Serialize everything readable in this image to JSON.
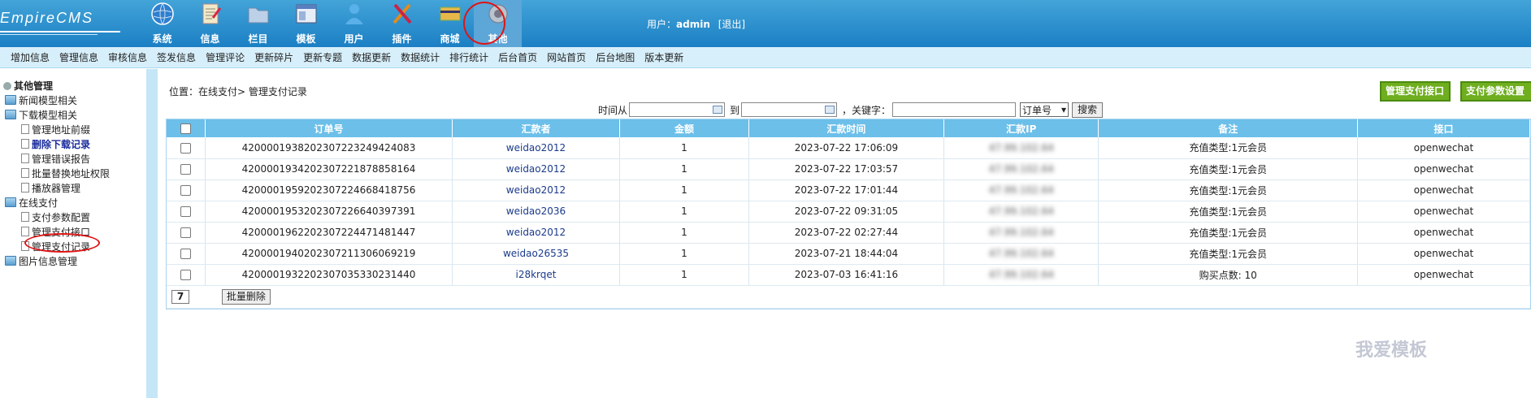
{
  "logo": {
    "text": "EmpireCMS"
  },
  "topnav": [
    {
      "label": "系统",
      "icon": "globe-icon"
    },
    {
      "label": "信息",
      "icon": "document-icon"
    },
    {
      "label": "栏目",
      "icon": "folder-icon"
    },
    {
      "label": "模板",
      "icon": "template-icon"
    },
    {
      "label": "用户",
      "icon": "user-icon"
    },
    {
      "label": "插件",
      "icon": "tools-icon"
    },
    {
      "label": "商城",
      "icon": "shop-icon"
    },
    {
      "label": "其他",
      "icon": "gear-icon"
    }
  ],
  "user": {
    "prefix": "用户：",
    "name": "admin",
    "logout": "[退出]"
  },
  "submenu": [
    "增加信息",
    "管理信息",
    "审核信息",
    "签发信息",
    "管理评论",
    "更新碎片",
    "更新专题",
    "数据更新",
    "数据统计",
    "排行统计",
    "后台首页",
    "网站首页",
    "后台地图",
    "版本更新"
  ],
  "tree": [
    {
      "label": "其他管理",
      "level": 0,
      "icon": "gear-icon"
    },
    {
      "label": "新闻模型相关",
      "level": 1,
      "icon": "folder-icon"
    },
    {
      "label": "下载模型相关",
      "level": 1,
      "icon": "folder-icon"
    },
    {
      "label": "管理地址前缀",
      "level": 2,
      "icon": "page-icon"
    },
    {
      "label": "删除下载记录",
      "level": 2,
      "icon": "page-icon",
      "bold": true
    },
    {
      "label": "管理错误报告",
      "level": 2,
      "icon": "page-icon"
    },
    {
      "label": "批量替换地址权限",
      "level": 2,
      "icon": "page-icon"
    },
    {
      "label": "播放器管理",
      "level": 2,
      "icon": "page-icon"
    },
    {
      "label": "在线支付",
      "level": 1,
      "icon": "folder-icon"
    },
    {
      "label": "支付参数配置",
      "level": 2,
      "icon": "page-icon"
    },
    {
      "label": "管理支付接口",
      "level": 2,
      "icon": "page-icon"
    },
    {
      "label": "管理支付记录",
      "level": 2,
      "icon": "page-icon"
    },
    {
      "label": "图片信息管理",
      "level": 1,
      "icon": "folder-icon"
    }
  ],
  "breadcrumb": "位置：在线支付> 管理支付记录",
  "buttons": {
    "manage_pay": "管理支付接口",
    "pay_config": "支付参数设置"
  },
  "search": {
    "from_label": "时间从",
    "to_label": "到",
    "keyword_label": "，关键字：",
    "field_select": "订单号",
    "button": "搜索"
  },
  "table": {
    "headers": [
      "",
      "订单号",
      "汇款者",
      "金额",
      "汇款时间",
      "汇款IP",
      "备注",
      "接口"
    ],
    "rows": [
      {
        "order": "4200001938202307223249424083",
        "user": "weidao2012",
        "amount": "1",
        "time": "2023-07-22 17:06:09",
        "ip": "47.99.102.64",
        "note": "充值类型:1元会员",
        "api": "openwechat"
      },
      {
        "order": "4200001934202307221878858164",
        "user": "weidao2012",
        "amount": "1",
        "time": "2023-07-22 17:03:57",
        "ip": "47.99.102.64",
        "note": "充值类型:1元会员",
        "api": "openwechat"
      },
      {
        "order": "4200001959202307224668418756",
        "user": "weidao2012",
        "amount": "1",
        "time": "2023-07-22 17:01:44",
        "ip": "47.99.102.64",
        "note": "充值类型:1元会员",
        "api": "openwechat"
      },
      {
        "order": "4200001953202307226640397391",
        "user": "weidao2036",
        "amount": "1",
        "time": "2023-07-22 09:31:05",
        "ip": "47.99.102.64",
        "note": "充值类型:1元会员",
        "api": "openwechat"
      },
      {
        "order": "4200001962202307224471481447",
        "user": "weidao2012",
        "amount": "1",
        "time": "2023-07-22 02:27:44",
        "ip": "47.99.102.64",
        "note": "充值类型:1元会员",
        "api": "openwechat"
      },
      {
        "order": "4200001940202307211306069219",
        "user": "weidao26535",
        "amount": "1",
        "time": "2023-07-21 18:44:04",
        "ip": "47.99.102.64",
        "note": "充值类型:1元会员",
        "api": "openwechat"
      },
      {
        "order": "4200001932202307035330231440",
        "user": "i28krqet",
        "amount": "1",
        "time": "2023-07-03 16:41:16",
        "ip": "47.99.102.64",
        "note": "购买点数: 10",
        "api": "openwechat"
      }
    ],
    "count": "7",
    "bulk_delete": "批量删除"
  },
  "watermark": "我爱模板"
}
